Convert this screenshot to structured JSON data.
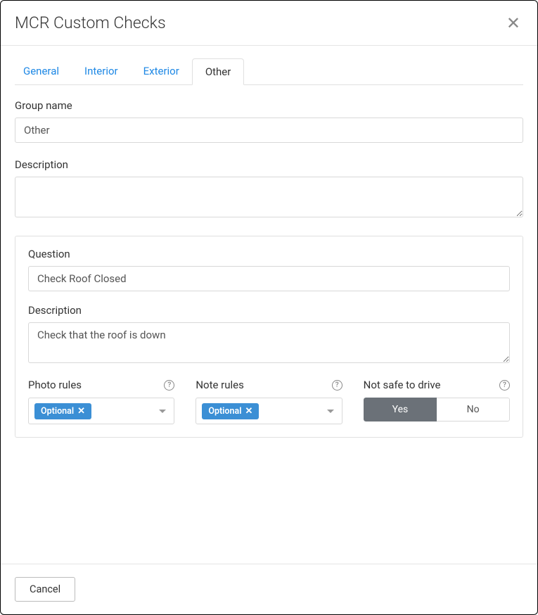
{
  "header": {
    "title": "MCR Custom Checks"
  },
  "tabs": [
    {
      "label": "General",
      "active": false
    },
    {
      "label": "Interior",
      "active": false
    },
    {
      "label": "Exterior",
      "active": false
    },
    {
      "label": "Other",
      "active": true
    }
  ],
  "group": {
    "name_label": "Group name",
    "name_value": "Other",
    "description_label": "Description",
    "description_value": ""
  },
  "question": {
    "question_label": "Question",
    "question_value": "Check Roof Closed",
    "description_label": "Description",
    "description_value": "Check that the roof is down",
    "photo_rules": {
      "label": "Photo rules",
      "tag": "Optional"
    },
    "note_rules": {
      "label": "Note rules",
      "tag": "Optional"
    },
    "not_safe": {
      "label": "Not safe to drive",
      "yes": "Yes",
      "no": "No",
      "selected": "yes"
    }
  },
  "footer": {
    "cancel": "Cancel"
  }
}
